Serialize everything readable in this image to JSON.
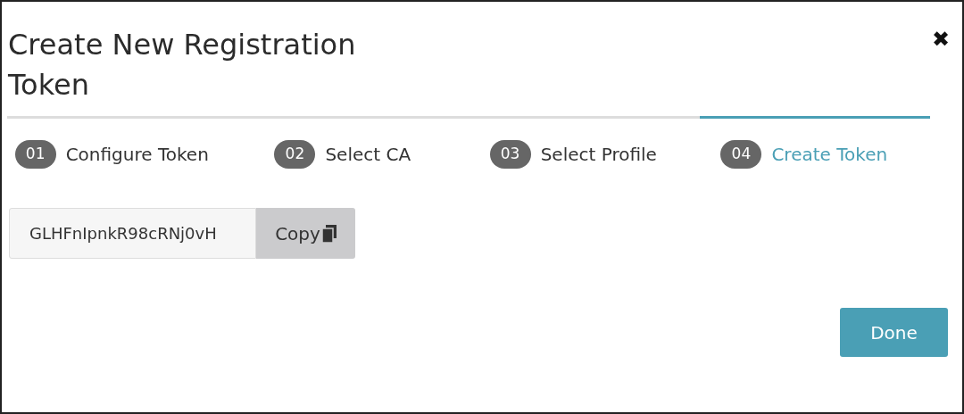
{
  "dialog": {
    "title": "Create New Registration Token",
    "close": "✖"
  },
  "steps": [
    {
      "number": "01",
      "label": "Configure Token",
      "selected": false
    },
    {
      "number": "02",
      "label": "Select CA",
      "selected": false
    },
    {
      "number": "03",
      "label": "Select Profile",
      "selected": false
    },
    {
      "number": "04",
      "label": "Create Token",
      "selected": true
    }
  ],
  "token": {
    "value": "GLHFnIpnkR98cRNj0vH",
    "copy_label": "Copy"
  },
  "buttons": {
    "done": "Done"
  }
}
